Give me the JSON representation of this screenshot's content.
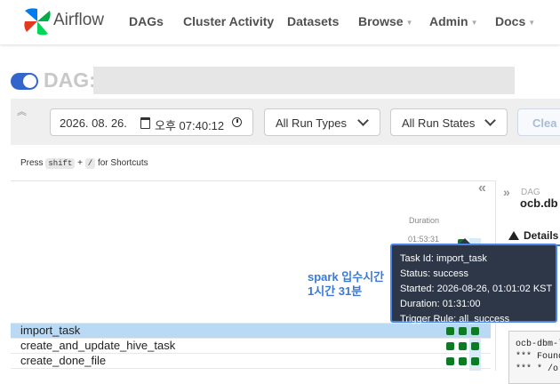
{
  "nav": {
    "brand": "Airflow",
    "items": [
      {
        "label": "DAGs",
        "has_caret": false
      },
      {
        "label": "Cluster Activity",
        "has_caret": false
      },
      {
        "label": "Datasets",
        "has_caret": false
      },
      {
        "label": "Browse",
        "has_caret": true
      },
      {
        "label": "Admin",
        "has_caret": true
      },
      {
        "label": "Docs",
        "has_caret": true
      }
    ]
  },
  "dag_header": {
    "label": "DAG:",
    "paused": false,
    "toggle_color": "#3366cc"
  },
  "filters": {
    "date": "2026. 08. 26.",
    "time": "오후 07:40:12",
    "run_types": "All Run Types",
    "run_states": "All Run States",
    "clear_label": "Clea"
  },
  "shortcuts": {
    "prefix": "Press",
    "key1": "shift",
    "plus": "+",
    "key2": "/",
    "suffix": "for Shortcuts"
  },
  "grid": {
    "duration_header": "Duration",
    "duration_value": "01:53:31",
    "annotation_line1": "spark 입수시간",
    "annotation_line2": "1시간 31분",
    "tasks": [
      {
        "label": "import_task",
        "selected": true
      },
      {
        "label": "create_and_update_hive_task",
        "selected": false
      },
      {
        "label": "create_done_file",
        "selected": false
      }
    ],
    "success_color": "#0e7a26"
  },
  "tooltip": {
    "task_id": "Task Id: import_task",
    "status": "Status: success",
    "started": "Started: 2026-08-26, 01:01:02 KST",
    "duration": "Duration: 01:31:00",
    "trigger_rule": "Trigger Rule: all_success"
  },
  "right_panel": {
    "dag_small": "DAG",
    "dag_id": "ocb.db",
    "details_tab": "Details",
    "log_line1": "ocb-dbm-l",
    "log_line2": "*** Found",
    "log_line3": "*** * /o"
  }
}
